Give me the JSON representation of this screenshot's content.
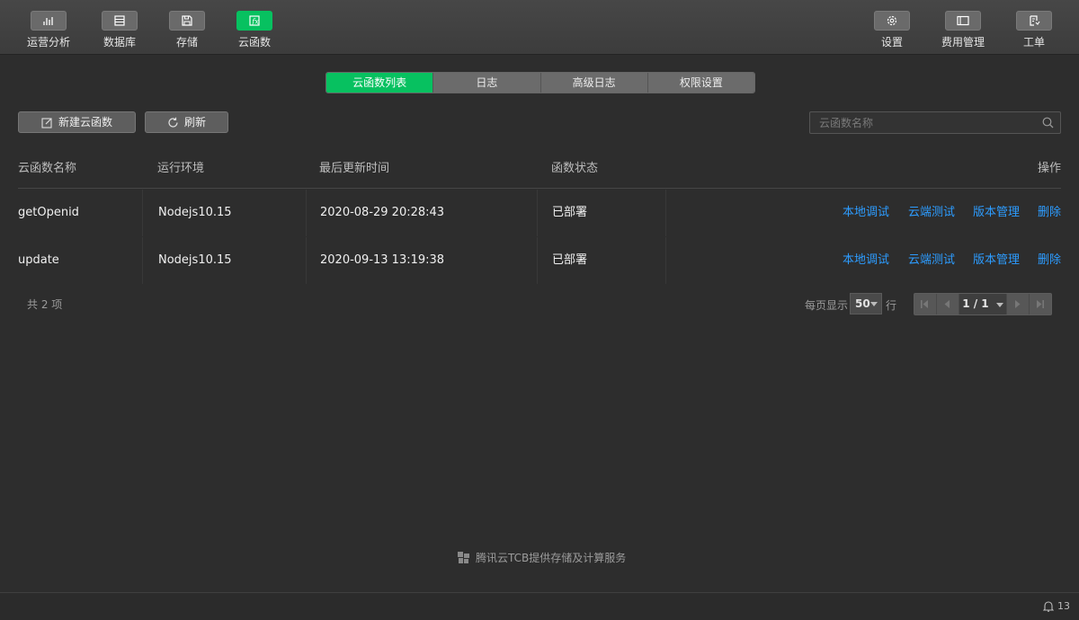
{
  "toolbar": {
    "left": [
      {
        "label": "运营分析",
        "icon": "bar-chart-icon"
      },
      {
        "label": "数据库",
        "icon": "database-icon"
      },
      {
        "label": "存储",
        "icon": "save-icon"
      },
      {
        "label": "云函数",
        "icon": "function-icon",
        "active": true
      }
    ],
    "right": [
      {
        "label": "设置",
        "icon": "gear-icon"
      },
      {
        "label": "费用管理",
        "icon": "billing-icon"
      },
      {
        "label": "工单",
        "icon": "ticket-icon"
      }
    ]
  },
  "tabs": [
    {
      "label": "云函数列表",
      "active": true
    },
    {
      "label": "日志"
    },
    {
      "label": "高级日志"
    },
    {
      "label": "权限设置"
    }
  ],
  "actions": {
    "new_label": "新建云函数",
    "refresh_label": "刷新"
  },
  "search": {
    "placeholder": "云函数名称",
    "value": ""
  },
  "table": {
    "headers": {
      "name": "云函数名称",
      "env": "运行环境",
      "updated": "最后更新时间",
      "status": "函数状态",
      "ops": "操作"
    },
    "rows": [
      {
        "name": "getOpenid",
        "env": "Nodejs10.15",
        "updated": "2020-08-29 20:28:43",
        "status": "已部署"
      },
      {
        "name": "update",
        "env": "Nodejs10.15",
        "updated": "2020-09-13 13:19:38",
        "status": "已部署"
      }
    ],
    "row_actions": [
      "本地调试",
      "云端测试",
      "版本管理",
      "删除"
    ]
  },
  "pagination": {
    "total_text": "共 2 项",
    "per_page_label": "每页显示",
    "per_page_value": "50",
    "per_page_unit": "行",
    "current": "1 / 1"
  },
  "footer": {
    "brand_text": "腾讯云TCB提供存储及计算服务"
  },
  "status": {
    "notification_count": "13"
  },
  "colors": {
    "accent": "#07c160",
    "link": "#2d9cff",
    "background": "#2d2d2d"
  }
}
